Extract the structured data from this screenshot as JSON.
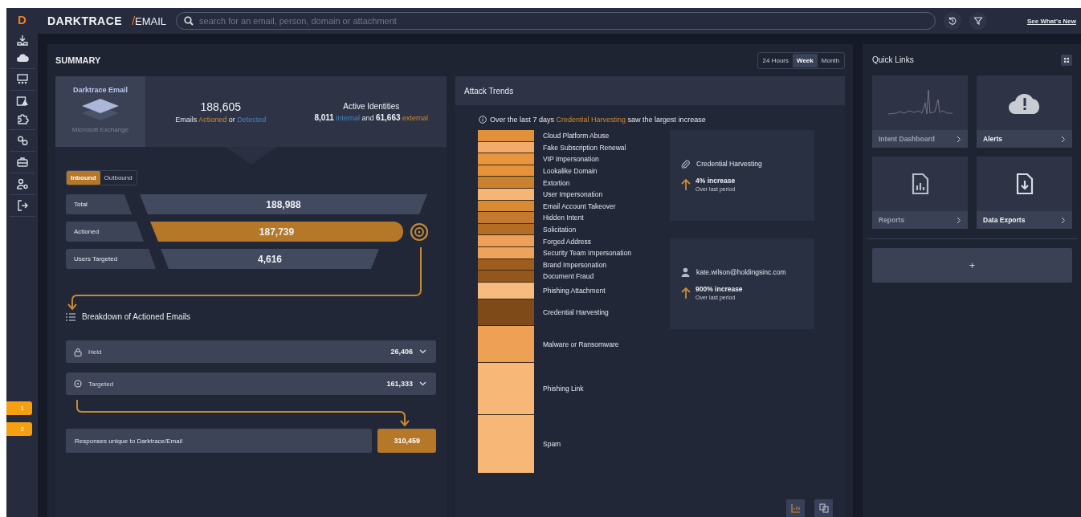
{
  "sidebar": {
    "logo_mark": "D",
    "badges": [
      "1",
      "2"
    ]
  },
  "topbar": {
    "brand": "DARKTRACE",
    "separator": "/",
    "product": "EMAIL",
    "search": {
      "placeholder": "search for an email, person, domain or attachment"
    },
    "link": "See What's New"
  },
  "summary": {
    "title": "SUMMARY",
    "ranges": [
      {
        "label": "24 Hours",
        "selected": false
      },
      {
        "label": "Week",
        "selected": true
      },
      {
        "label": "Month",
        "selected": false
      }
    ],
    "product_tile": {
      "title": "Darktrace Email",
      "subtitle": "Microsoft Exchange"
    },
    "emails": {
      "count": "188,605",
      "caption": [
        {
          "text": "Emails ",
          "kind": "plain"
        },
        {
          "text": "Actioned",
          "kind": "actioned"
        },
        {
          "text": " or ",
          "kind": "plain"
        },
        {
          "text": "Detected",
          "kind": "detected"
        }
      ]
    },
    "identities": {
      "title": "Active Identities",
      "caption": [
        {
          "text": "8,011",
          "kind": "number"
        },
        {
          "text": " internal",
          "kind": "detected"
        },
        {
          "text": " and ",
          "kind": "plain"
        },
        {
          "text": "61,663",
          "kind": "number"
        },
        {
          "text": " external",
          "kind": "actioned"
        }
      ]
    },
    "directions": [
      {
        "label": "Inbound",
        "selected": true
      },
      {
        "label": "Outbound",
        "selected": false
      }
    ],
    "funnel": [
      {
        "label": "Total",
        "value": "188,988",
        "highlighted": false
      },
      {
        "label": "Actioned",
        "value": "187,739",
        "highlighted": true
      },
      {
        "label": "Users Targeted",
        "value": "4,616",
        "highlighted": false
      }
    ],
    "breakdown_title": "Breakdown of Actioned Emails",
    "breakdown": [
      {
        "kind": "lock",
        "label": "Held",
        "value": "26,406",
        "expanded": false
      },
      {
        "kind": "target",
        "label": "Targeted",
        "value": "161,333",
        "expanded": false
      }
    ],
    "responses": {
      "label": "Responses unique to Darktrace/Email",
      "value": "310,459"
    }
  },
  "attack_trends": {
    "title": "Attack Trends",
    "note": [
      {
        "text": "Over the last 7 days ",
        "kind": "plain"
      },
      {
        "text": "Credential Harvesting",
        "kind": "actioned"
      },
      {
        "text": " saw the largest increase",
        "kind": "plain"
      }
    ],
    "segments": [
      {
        "label": "Cloud Platform Abuse",
        "color": "#e0913a"
      },
      {
        "label": "Fake Subscription Renewal",
        "color": "#f2ab68"
      },
      {
        "label": "VIP Impersonation",
        "color": "#e8953d"
      },
      {
        "label": "Lookalike Domain",
        "color": "#e5923b"
      },
      {
        "label": "Extortion",
        "color": "#c9802f"
      },
      {
        "label": "User Impersonation",
        "color": "#f5b574"
      },
      {
        "label": "Email Account Takeover",
        "color": "#d98a35"
      },
      {
        "label": "Hidden Intent",
        "color": "#c47a2c"
      },
      {
        "label": "Solicitation",
        "color": "#b46d24"
      },
      {
        "label": "Forged Address",
        "color": "#eea058"
      },
      {
        "label": "Security Team Impersonation",
        "color": "#eda35a"
      },
      {
        "label": "Brand Impersonation",
        "color": "#9c5d1f"
      },
      {
        "label": "Document Fraud",
        "color": "#94561c"
      },
      {
        "label": "Phishing Attachment",
        "color": "#f7bb7d"
      },
      {
        "label": "Credential Harvesting",
        "color": "#7e4a18"
      },
      {
        "label": "Malware or Ransomware",
        "color": "#eea155"
      },
      {
        "label": "Phishing Link",
        "color": "#f6b777"
      },
      {
        "label": "Spam",
        "color": "#f6b777"
      }
    ],
    "highlights": [
      {
        "kind": "category",
        "label": "Credential Harvesting",
        "change": "4% increase",
        "period": "Over last period"
      },
      {
        "kind": "person",
        "label": "kate.wilson@holdingsinc.com",
        "change": "900% increase",
        "period": "Over last period"
      }
    ],
    "chart_tools": [
      {
        "kind": "chart",
        "selected": true
      },
      {
        "kind": "copy",
        "selected": false
      }
    ]
  },
  "quick_links": {
    "title": "Quick Links",
    "tiles": [
      {
        "kind": "sparkline",
        "label": "Intent Dashboard",
        "highlighted": false
      },
      {
        "kind": "cloud",
        "label": "Alerts",
        "highlighted": true
      },
      {
        "kind": "report",
        "label": "Reports",
        "highlighted": false
      },
      {
        "kind": "export",
        "label": "Data Exports",
        "highlighted": true
      }
    ],
    "add_label": "+"
  }
}
